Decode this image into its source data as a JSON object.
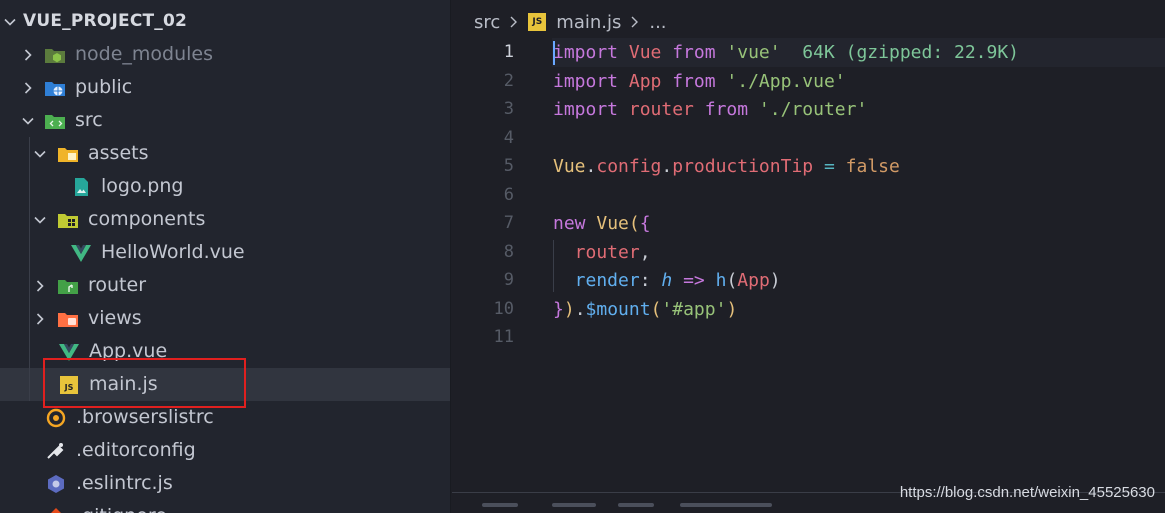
{
  "explorer": {
    "root": "VUE_PROJECT_02",
    "items": [
      {
        "label": "node_modules",
        "icon": "node-folder-icon",
        "muted": true
      },
      {
        "label": "public",
        "icon": "public-folder-icon"
      },
      {
        "label": "src",
        "icon": "src-folder-icon"
      },
      {
        "label": "assets",
        "icon": "assets-folder-icon"
      },
      {
        "label": "logo.png",
        "icon": "image-file-icon"
      },
      {
        "label": "components",
        "icon": "components-folder-icon"
      },
      {
        "label": "HelloWorld.vue",
        "icon": "vue-file-icon"
      },
      {
        "label": "router",
        "icon": "router-folder-icon"
      },
      {
        "label": "views",
        "icon": "views-folder-icon"
      },
      {
        "label": "App.vue",
        "icon": "vue-file-icon"
      },
      {
        "label": "main.js",
        "icon": "js-file-icon",
        "selected": true
      },
      {
        "label": ".browserslistrc",
        "icon": "browserslist-icon"
      },
      {
        "label": ".editorconfig",
        "icon": "editorconfig-icon"
      },
      {
        "label": ".eslintrc.js",
        "icon": "eslint-icon"
      },
      {
        "label": ".gitignore",
        "icon": "git-icon"
      }
    ]
  },
  "breadcrumb": {
    "folder": "src",
    "file_badge": "JS",
    "file": "main.js",
    "more": "..."
  },
  "editor": {
    "active_line": 1,
    "line_numbers": [
      "1",
      "2",
      "3",
      "4",
      "5",
      "6",
      "7",
      "8",
      "9",
      "10",
      "11"
    ],
    "lines": {
      "l1": {
        "kw1": "import",
        "name": " Vue ",
        "kw2": "from",
        "src": " 'vue'",
        "hint": "  64K (gzipped: 22.9K)"
      },
      "l2": {
        "kw1": "import",
        "name": " App ",
        "kw2": "from",
        "src": " './App.vue'"
      },
      "l3": {
        "kw1": "import",
        "name": " router ",
        "kw2": "from",
        "src": " './router'"
      },
      "l5": {
        "obj": "Vue",
        "dot1": ".",
        "p1": "config",
        "dot2": ".",
        "p2": "productionTip",
        "eq": " = ",
        "val": "false"
      },
      "l7": {
        "kw": "new",
        "cls": " Vue",
        "paren": "(",
        "brace": "{"
      },
      "l8": {
        "prop": "  router",
        "comma": ","
      },
      "l9": {
        "prop": "  render",
        "colon": ": ",
        "param": "h",
        "arrow": " => ",
        "fn": "h",
        "open": "(",
        "arg": "App",
        "close": ")"
      },
      "l10": {
        "brace": "}",
        "paren": ")",
        "dot": ".",
        "fn": "$mount",
        "open": "(",
        "str": "'#app'",
        "close": ")"
      }
    }
  },
  "colors": {
    "accent_highlight": "#e0201f",
    "js_badge": "#e8c43b"
  },
  "watermark": "https://blog.csdn.net/weixin_45525630"
}
